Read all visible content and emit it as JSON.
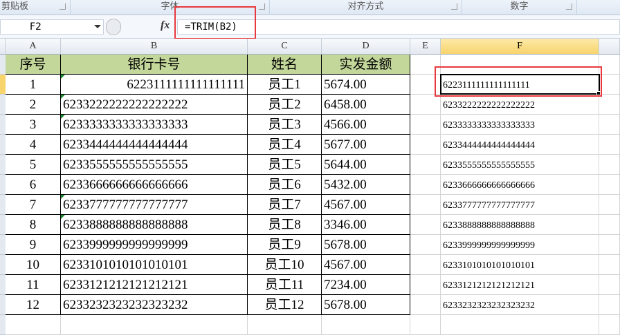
{
  "ribbon": {
    "groups": [
      {
        "label": "剪贴板"
      },
      {
        "label": "字体"
      },
      {
        "label": "对齐方式"
      },
      {
        "label": "数字"
      }
    ]
  },
  "formula_bar": {
    "name_box": "F2",
    "fx": "fx",
    "formula": "=TRIM(B2)"
  },
  "columns": [
    "A",
    "B",
    "C",
    "D",
    "E",
    "F"
  ],
  "headers": [
    "序号",
    "银行卡号",
    "姓名",
    "实发金额"
  ],
  "rows": [
    {
      "no": "1",
      "card": "6223111111111111111",
      "name": "员工1",
      "amount": "5674.00",
      "trim": "6223111111111111111"
    },
    {
      "no": "2",
      "card": "6233222222222222222",
      "name": "员工2",
      "amount": "6458.00",
      "trim": "6233222222222222222"
    },
    {
      "no": "3",
      "card": "6233333333333333333",
      "name": "员工3",
      "amount": "4566.00",
      "trim": "6233333333333333333"
    },
    {
      "no": "4",
      "card": "6233444444444444444",
      "name": "员工4",
      "amount": "5677.00",
      "trim": "6233444444444444444"
    },
    {
      "no": "5",
      "card": "6233555555555555555",
      "name": "员工5",
      "amount": "5644.00",
      "trim": "6233555555555555555"
    },
    {
      "no": "6",
      "card": "6233666666666666666",
      "name": "员工6",
      "amount": "5432.00",
      "trim": "6233666666666666666"
    },
    {
      "no": "7",
      "card": "6233777777777777777",
      "name": "员工7",
      "amount": "4567.00",
      "trim": "6233777777777777777"
    },
    {
      "no": "8",
      "card": "6233888888888888888",
      "name": "员工8",
      "amount": "3346.00",
      "trim": "6233888888888888888"
    },
    {
      "no": "9",
      "card": "6233999999999999999",
      "name": "员工9",
      "amount": "5678.00",
      "trim": "6233999999999999999"
    },
    {
      "no": "10",
      "card": "6233101010101010101",
      "name": "员工10",
      "amount": "4567.00",
      "trim": "6233101010101010101"
    },
    {
      "no": "11",
      "card": "6233121212121212121",
      "name": "员工11",
      "amount": "7234.00",
      "trim": "6233121212121212121"
    },
    {
      "no": "12",
      "card": "6233232323232323232",
      "name": "员工12",
      "amount": "5678.00",
      "trim": "6233232323232323232"
    }
  ],
  "colors": {
    "header_fill": "#c4d79b",
    "highlight": "#e8383d",
    "error_triangle": "#1e8a2e"
  }
}
